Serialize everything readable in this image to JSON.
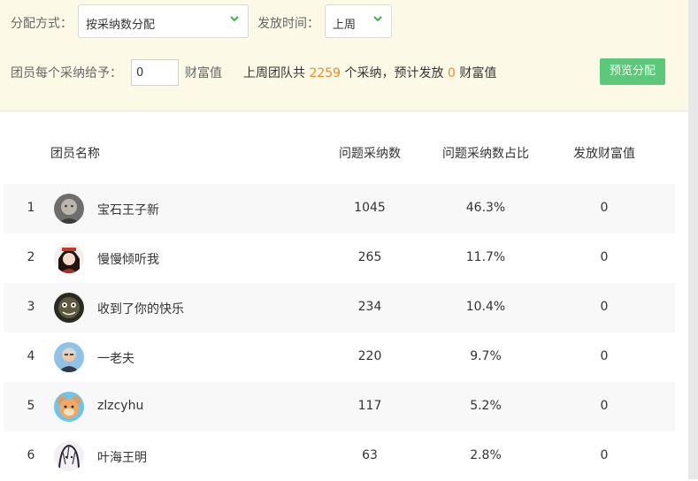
{
  "filters": {
    "method_label": "分配方式：",
    "method_value": "按采纳数分配",
    "time_label": "发放时间：",
    "time_value": "上周"
  },
  "allocation": {
    "per_label": "团员每个采纳给予：",
    "per_value": "0",
    "unit": "财富值",
    "summary_prefix": "上周团队共",
    "total_adoptions": "2259",
    "summary_mid": "个采纳，预计发放",
    "estimated": "0",
    "summary_unit": "财富值",
    "preview_label": "预览分配"
  },
  "table": {
    "headers": [
      "团员名称",
      "问题采纳数",
      "问题采纳数占比",
      "发放财富值"
    ],
    "rows": [
      {
        "index": "1",
        "name": "宝石王子新",
        "count": "1045",
        "percent": "46.3%",
        "wealth": "0",
        "avatar": "child-photo"
      },
      {
        "index": "2",
        "name": "慢慢倾听我",
        "count": "265",
        "percent": "11.7%",
        "wealth": "0",
        "avatar": "costume-girl"
      },
      {
        "index": "3",
        "name": "收到了你的快乐",
        "count": "234",
        "percent": "10.4%",
        "wealth": "0",
        "avatar": "cartoon-face"
      },
      {
        "index": "4",
        "name": "一老夫",
        "count": "220",
        "percent": "9.7%",
        "wealth": "0",
        "avatar": "old-man"
      },
      {
        "index": "5",
        "name": "zlzcyhu",
        "count": "117",
        "percent": "5.2%",
        "wealth": "0",
        "avatar": "bear-cartoon"
      },
      {
        "index": "6",
        "name": "叶海王明",
        "count": "63",
        "percent": "2.8%",
        "wealth": "0",
        "avatar": "anime-sketch"
      }
    ]
  },
  "colors": {
    "accent_orange": "#f08a24",
    "button_green": "#5cc87a",
    "chevron_green": "#3ab54a",
    "header_bg": "#fdf9e7"
  }
}
